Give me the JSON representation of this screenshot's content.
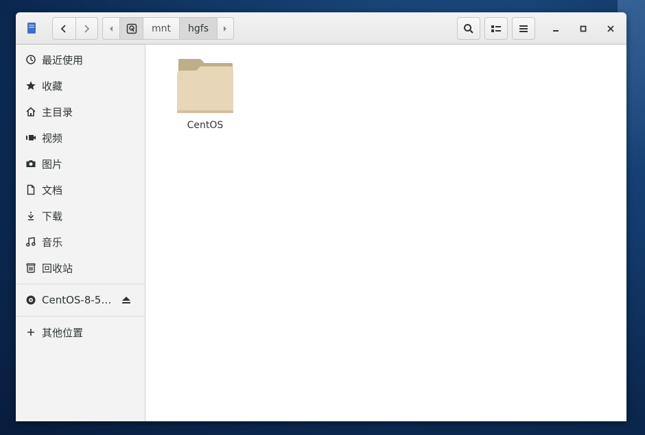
{
  "window": {
    "path": {
      "root_icon": "drive-icon",
      "segments": [
        "mnt",
        "hgfs"
      ],
      "active": "hgfs"
    },
    "toolbar": {
      "back_icon": "chevron-left-icon",
      "forward_icon": "chevron-right-icon",
      "search_icon": "search-icon",
      "view_icon": "list-view-icon",
      "menu_icon": "hamburger-menu-icon",
      "minimize_icon": "minimize-icon",
      "maximize_icon": "maximize-icon",
      "close_icon": "close-icon"
    }
  },
  "sidebar": {
    "items": [
      {
        "label": "最近使用",
        "icon": "clock-icon"
      },
      {
        "label": "收藏",
        "icon": "star-icon"
      },
      {
        "label": "主目录",
        "icon": "home-icon"
      },
      {
        "label": "视频",
        "icon": "video-icon"
      },
      {
        "label": "图片",
        "icon": "camera-icon"
      },
      {
        "label": "文档",
        "icon": "document-icon"
      },
      {
        "label": "下载",
        "icon": "download-icon"
      },
      {
        "label": "音乐",
        "icon": "music-icon"
      },
      {
        "label": "回收站",
        "icon": "trash-icon"
      }
    ],
    "devices": [
      {
        "label": "CentOS-8-5…",
        "icon": "disc-icon",
        "action_icon": "eject-icon"
      }
    ],
    "other": {
      "label": "其他位置",
      "icon": "plus-icon"
    }
  },
  "files": [
    {
      "name": "CentOS",
      "icon": "folder-icon"
    }
  ],
  "colors": {
    "folder_back": "#bfae8a",
    "folder_front": "#e8d6b8",
    "desktop": "#123b6b"
  }
}
